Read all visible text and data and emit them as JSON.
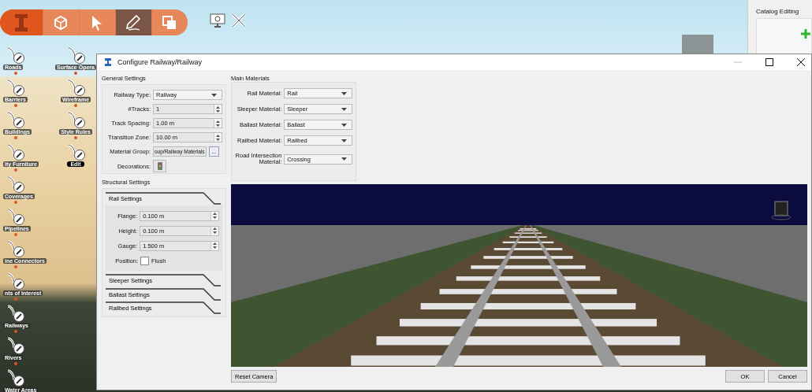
{
  "toolbar": {
    "tools": [
      {
        "selected": false
      },
      {
        "selected": false
      },
      {
        "selected": true
      },
      {
        "selected": false
      }
    ]
  },
  "sidebar": {
    "columns": [
      [
        {
          "label": "Roads",
          "selected": false
        },
        {
          "label": "Barriers",
          "selected": false
        },
        {
          "label": "Buildings",
          "selected": false
        },
        {
          "label": "ity Furniture",
          "selected": false
        },
        {
          "label": "Coverages",
          "selected": false
        },
        {
          "label": "Pipelines",
          "selected": false
        },
        {
          "label": "ine Connectors",
          "selected": false
        },
        {
          "label": "nts of Interest",
          "selected": false
        },
        {
          "label": "Railways",
          "selected": false
        },
        {
          "label": "Rivers",
          "selected": false
        },
        {
          "label": "Water Areas",
          "selected": false
        }
      ],
      [
        {
          "label": "Surface Opera",
          "selected": false
        },
        {
          "label": "Wireframe",
          "selected": false
        },
        {
          "label": "Style Rules",
          "selected": false
        },
        {
          "label": "Edit",
          "selected": true
        }
      ]
    ]
  },
  "catalog_panel": {
    "title": "Catalog Editing"
  },
  "dialog": {
    "title": "Configure Railway/Railway",
    "general_settings": {
      "title": "General Settings",
      "fields": [
        {
          "label": "Railway Type:",
          "kind": "dropdown",
          "value": "Railway"
        },
        {
          "label": "#Tracks:",
          "kind": "spinbox",
          "value": "1"
        },
        {
          "label": "Track Spacing:",
          "kind": "spinbox",
          "value": "1.00 m"
        },
        {
          "label": "Transition Zone:",
          "kind": "spinbox",
          "value": "10.00 m"
        },
        {
          "label": "Material Group:",
          "kind": "path",
          "value": "oup/Railway Materials",
          "button": "..."
        },
        {
          "label": "Decorations:",
          "kind": "icon_button"
        }
      ]
    },
    "main_materials": {
      "title": "Main Materials",
      "fields": [
        {
          "label": "Rail Material:",
          "value": "Rail"
        },
        {
          "label": "Sleeper Material:",
          "value": "Sleeper"
        },
        {
          "label": "Ballast Material:",
          "value": "Ballast"
        },
        {
          "label": "Railbed Material:",
          "value": "Railbed"
        },
        {
          "label": "Road Intersection Material:",
          "value": "Crossing"
        }
      ]
    },
    "structural_settings": {
      "title": "Structural Settings",
      "sections": [
        {
          "label": "Rail Settings",
          "expanded": true,
          "fields": [
            {
              "label": "Flange:",
              "kind": "spinbox",
              "value": "0.100 m"
            },
            {
              "label": "Height:",
              "kind": "spinbox",
              "value": "0.100 m"
            },
            {
              "label": "Gauge:",
              "kind": "spinbox",
              "value": "1.500 m"
            },
            {
              "label": "Position:",
              "kind": "checkbox",
              "text": "Flush",
              "checked": false
            }
          ]
        },
        {
          "label": "Sleeper Settings",
          "expanded": false
        },
        {
          "label": "Ballast Settings",
          "expanded": false
        },
        {
          "label": "Railbed Settings",
          "expanded": false
        }
      ]
    },
    "reset_button": "Reset Camera",
    "buttons": [
      "OK",
      "Cancel"
    ]
  }
}
